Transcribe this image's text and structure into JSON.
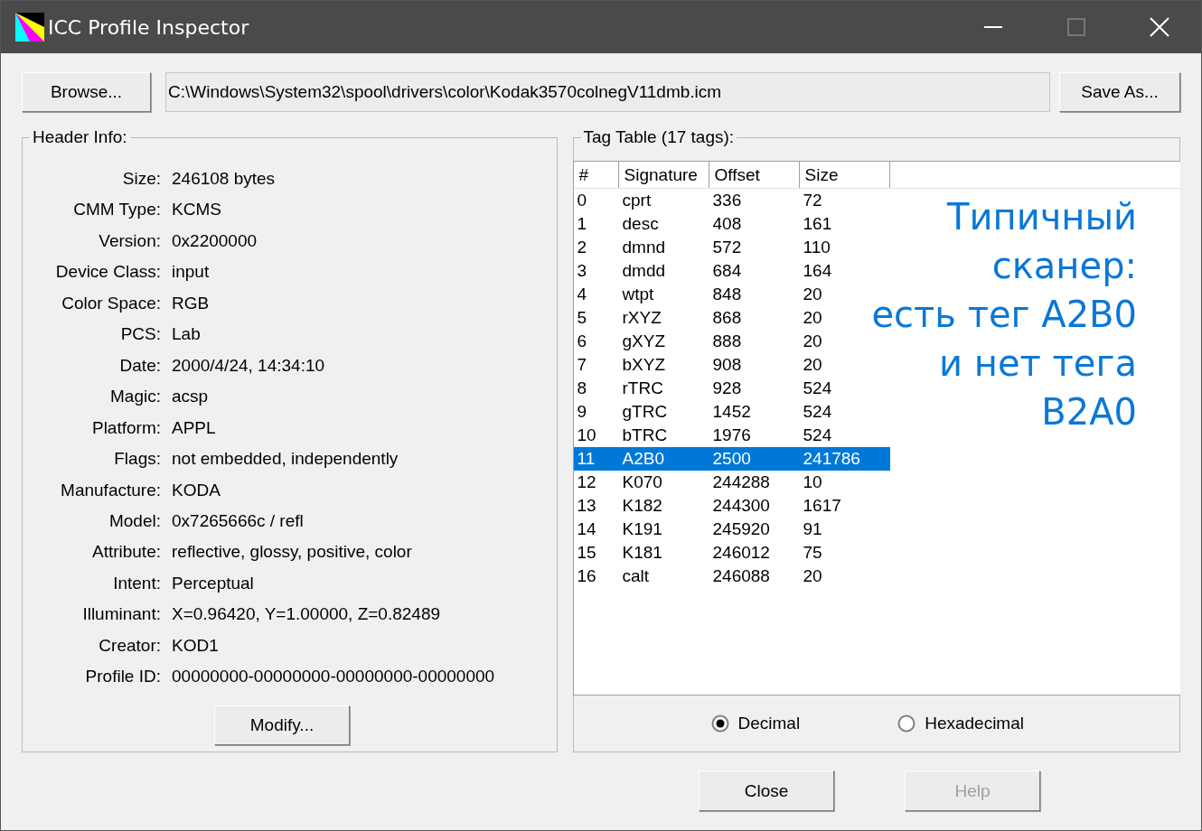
{
  "window": {
    "title": "ICC Profile Inspector"
  },
  "toolbar": {
    "browse_button": "Browse...",
    "path": "C:\\Windows\\System32\\spool\\drivers\\color\\Kodak3570colnegV11dmb.icm",
    "save_button": "Save As..."
  },
  "header_info": {
    "title": "Header Info:",
    "fields": [
      {
        "label": "Size:",
        "value": "246108 bytes"
      },
      {
        "label": "CMM Type:",
        "value": "KCMS"
      },
      {
        "label": "Version:",
        "value": "0x2200000"
      },
      {
        "label": "Device Class:",
        "value": "input"
      },
      {
        "label": "Color Space:",
        "value": "RGB"
      },
      {
        "label": "PCS:",
        "value": "Lab"
      },
      {
        "label": "Date:",
        "value": "2000/4/24, 14:34:10"
      },
      {
        "label": "Magic:",
        "value": "acsp"
      },
      {
        "label": "Platform:",
        "value": "APPL"
      },
      {
        "label": "Flags:",
        "value": "not embedded, independently"
      },
      {
        "label": "Manufacture:",
        "value": "KODA"
      },
      {
        "label": "Model:",
        "value": "0x7265666c / refl"
      },
      {
        "label": "Attribute:",
        "value": "reflective, glossy, positive, color"
      },
      {
        "label": "Intent:",
        "value": "Perceptual"
      },
      {
        "label": "Illuminant:",
        "value": "X=0.96420, Y=1.00000, Z=0.82489"
      },
      {
        "label": "Creator:",
        "value": "KOD1"
      },
      {
        "label": "Profile ID:",
        "value": "00000000-00000000-00000000-00000000"
      }
    ],
    "modify_button": "Modify..."
  },
  "tag_table": {
    "title": "Tag Table (17 tags):",
    "columns": [
      "#",
      "Signature",
      "Offset",
      "Size"
    ],
    "rows": [
      {
        "cells": [
          "0",
          "cprt",
          "336",
          "72"
        ],
        "selected": false
      },
      {
        "cells": [
          "1",
          "desc",
          "408",
          "161"
        ],
        "selected": false
      },
      {
        "cells": [
          "2",
          "dmnd",
          "572",
          "110"
        ],
        "selected": false
      },
      {
        "cells": [
          "3",
          "dmdd",
          "684",
          "164"
        ],
        "selected": false
      },
      {
        "cells": [
          "4",
          "wtpt",
          "848",
          "20"
        ],
        "selected": false
      },
      {
        "cells": [
          "5",
          "rXYZ",
          "868",
          "20"
        ],
        "selected": false
      },
      {
        "cells": [
          "6",
          "gXYZ",
          "888",
          "20"
        ],
        "selected": false
      },
      {
        "cells": [
          "7",
          "bXYZ",
          "908",
          "20"
        ],
        "selected": false
      },
      {
        "cells": [
          "8",
          "rTRC",
          "928",
          "524"
        ],
        "selected": false
      },
      {
        "cells": [
          "9",
          "gTRC",
          "1452",
          "524"
        ],
        "selected": false
      },
      {
        "cells": [
          "10",
          "bTRC",
          "1976",
          "524"
        ],
        "selected": false
      },
      {
        "cells": [
          "11",
          "A2B0",
          "2500",
          "241786"
        ],
        "selected": true
      },
      {
        "cells": [
          "12",
          "K070",
          "244288",
          "10"
        ],
        "selected": false
      },
      {
        "cells": [
          "13",
          "K182",
          "244300",
          "1617"
        ],
        "selected": false
      },
      {
        "cells": [
          "14",
          "K191",
          "245920",
          "91"
        ],
        "selected": false
      },
      {
        "cells": [
          "15",
          "K181",
          "246012",
          "75"
        ],
        "selected": false
      },
      {
        "cells": [
          "16",
          "calt",
          "246088",
          "20"
        ],
        "selected": false
      }
    ],
    "annotation": [
      "Типичный",
      "сканер:",
      "есть тег A2B0",
      "и нет тега",
      "B2A0"
    ],
    "number_format": [
      {
        "label": "Decimal",
        "selected": true
      },
      {
        "label": "Hexadecimal",
        "selected": false
      }
    ]
  },
  "footer_buttons": [
    {
      "label": "Close",
      "disabled": false
    },
    {
      "label": "Help",
      "disabled": true
    }
  ]
}
